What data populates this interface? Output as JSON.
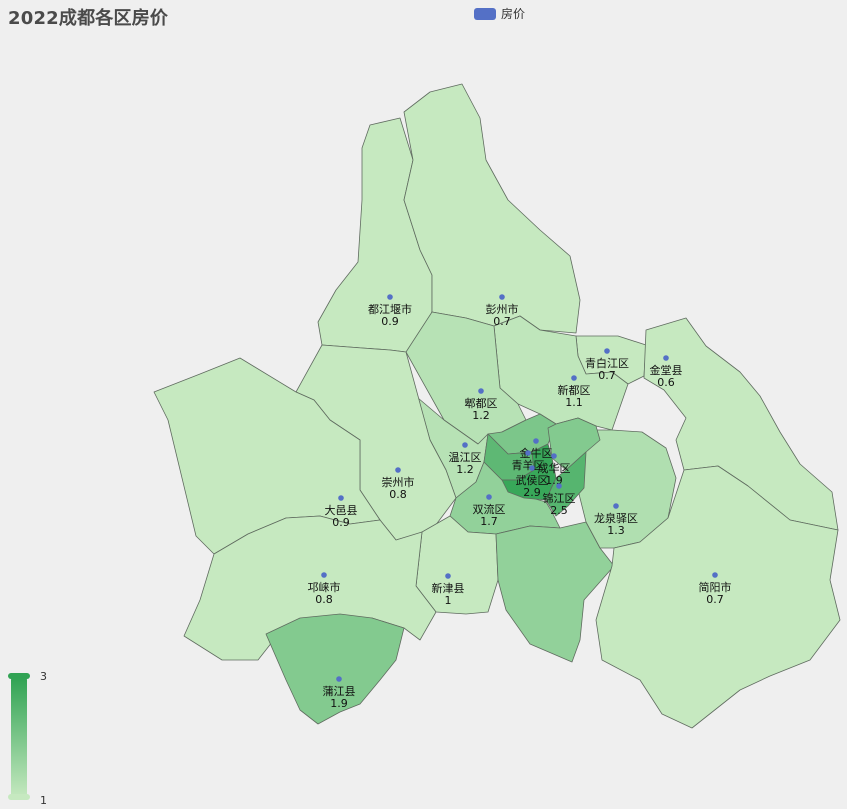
{
  "title": "2022成都各区房价",
  "legend": {
    "label": "房价",
    "color": "#5470c6"
  },
  "visual_map": {
    "min": "1",
    "max": "3",
    "low_color": "#c6e9c0",
    "high_color": "#31a354"
  },
  "chart_data": {
    "type": "choropleth",
    "title": "2022成都各区房价",
    "series": [
      {
        "name": "房价"
      }
    ],
    "regions": [
      {
        "name": "都江堰市",
        "value": 0.9
      },
      {
        "name": "彭州市",
        "value": 0.7
      },
      {
        "name": "青白江区",
        "value": 0.7
      },
      {
        "name": "金堂县",
        "value": 0.6
      },
      {
        "name": "新都区",
        "value": 1.1
      },
      {
        "name": "郫都区",
        "value": 1.2
      },
      {
        "name": "温江区",
        "value": 1.2
      },
      {
        "name": "崇州市",
        "value": 0.8
      },
      {
        "name": "大邑县",
        "value": 0.9
      },
      {
        "name": "双流区",
        "value": 1.7
      },
      {
        "name": "龙泉驿区",
        "value": 1.3
      },
      {
        "name": "邛崃市",
        "value": 0.8
      },
      {
        "name": "新津县",
        "value": 1
      },
      {
        "name": "简阳市",
        "value": 0.7
      },
      {
        "name": "蒲江县",
        "value": 1.9
      },
      {
        "name": "金牛区",
        "value": ""
      },
      {
        "name": "青羊区",
        "value": ""
      },
      {
        "name": "成华区",
        "value": 1.9
      },
      {
        "name": "武侯区",
        "value": 2.9
      },
      {
        "name": "锦江区",
        "value": 2.5
      }
    ],
    "visual_range": [
      1,
      3
    ]
  }
}
